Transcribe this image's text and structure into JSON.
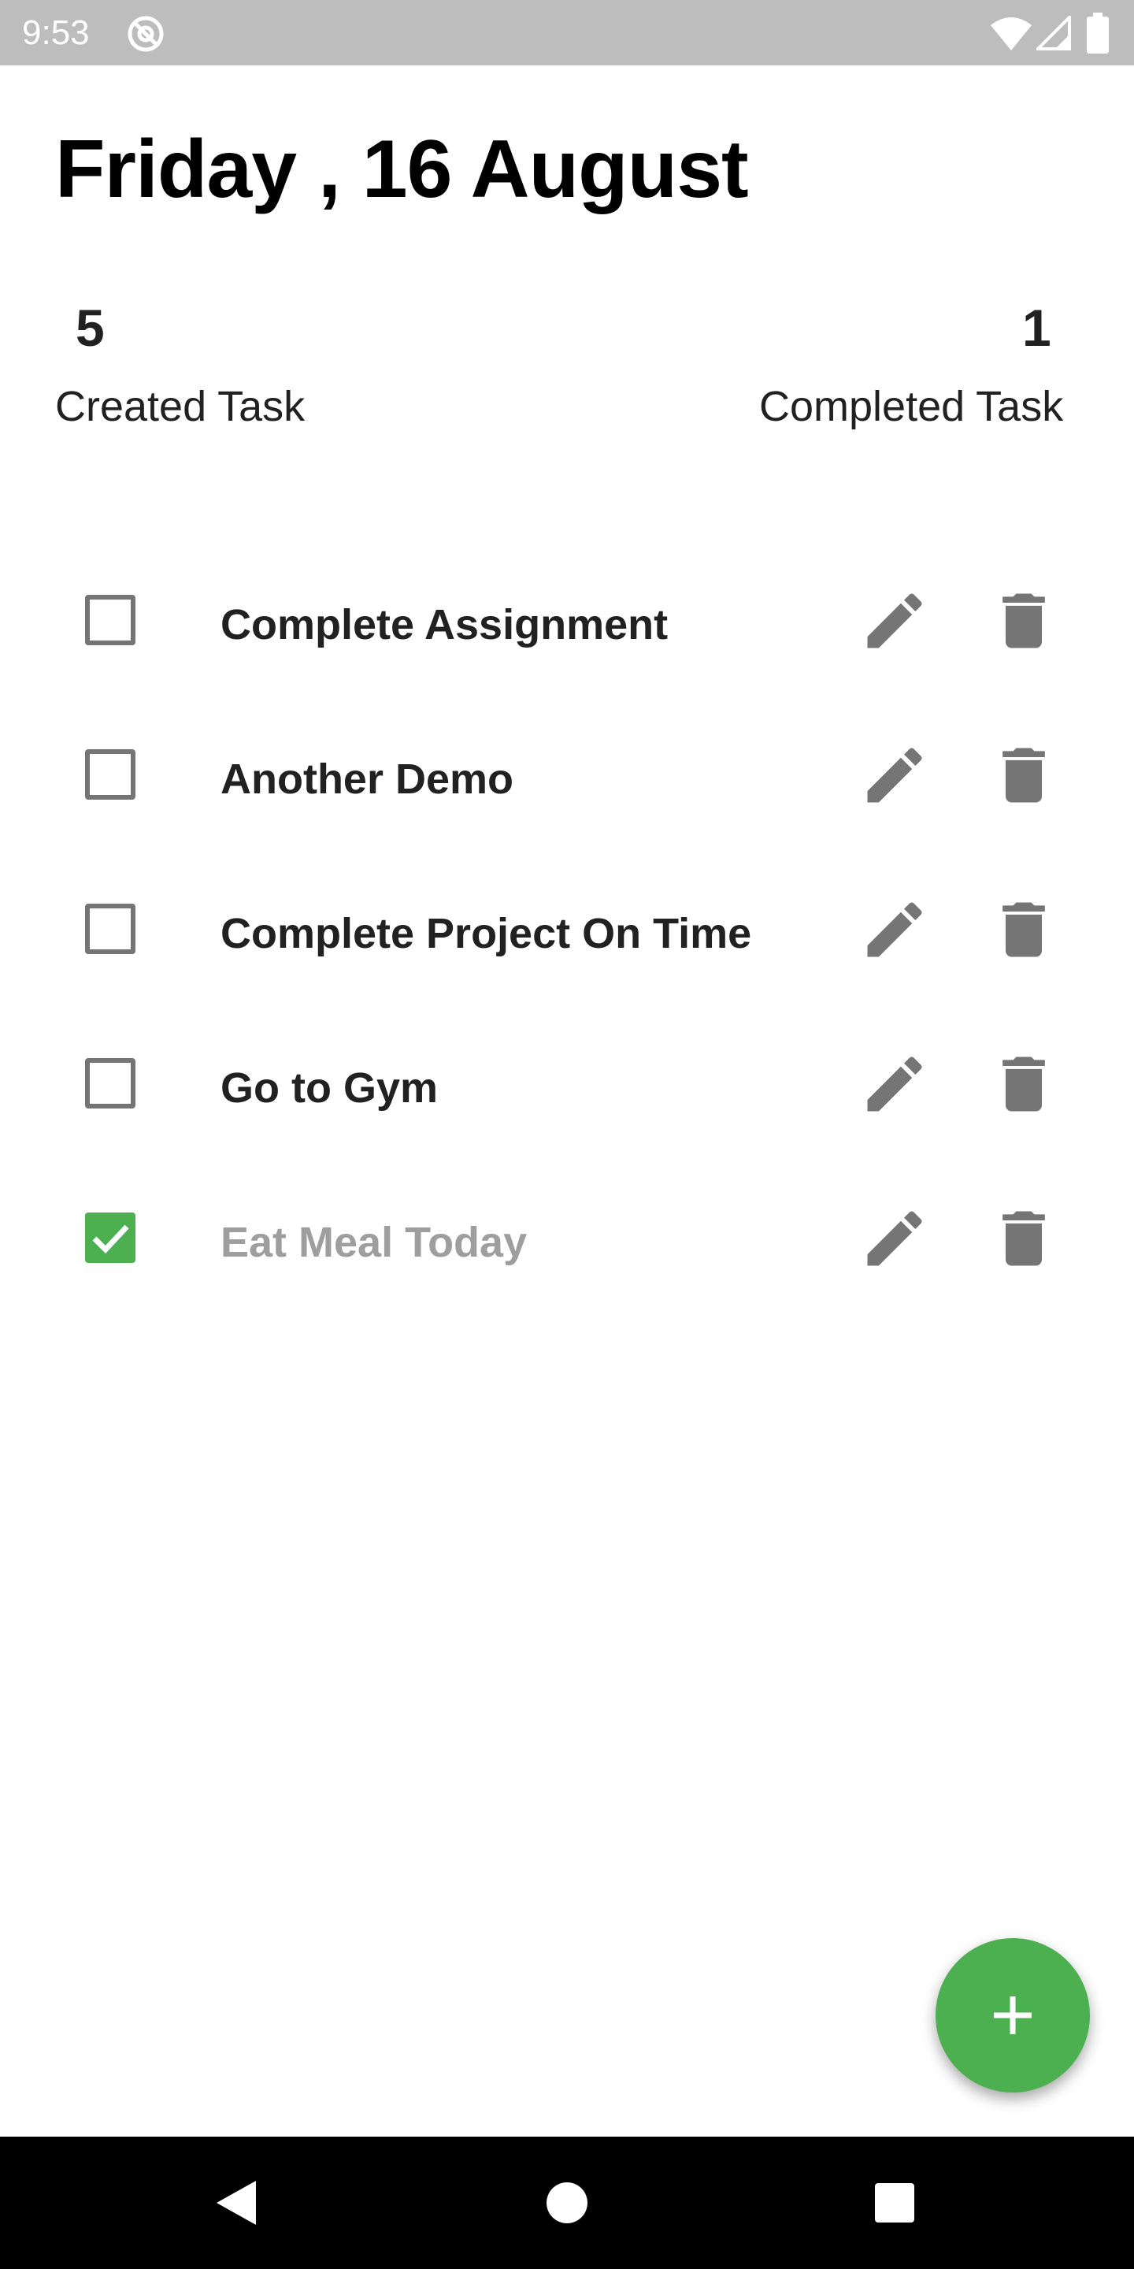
{
  "status_bar": {
    "time": "9:53",
    "icons": [
      "at-sign-icon",
      "wifi-icon",
      "cell-signal-icon",
      "battery-icon"
    ]
  },
  "header": {
    "title": "Friday , 16 August"
  },
  "stats": {
    "created_count": "5",
    "created_label": "Created Task",
    "completed_count": "1",
    "completed_label": "Completed Task"
  },
  "tasks": [
    {
      "title": "Complete Assignment",
      "checked": false
    },
    {
      "title": "Another Demo",
      "checked": false
    },
    {
      "title": "Complete Project On Time",
      "checked": false
    },
    {
      "title": "Go to Gym",
      "checked": false
    },
    {
      "title": "Eat Meal Today",
      "checked": true
    }
  ],
  "task_actions": [
    "pencil-icon",
    "trash-icon"
  ],
  "fab": {
    "icon": "plus-icon"
  },
  "nav_bar": {
    "buttons": [
      "back-icon",
      "home-icon",
      "recents-icon"
    ]
  },
  "colors": {
    "accent": "#4caf50",
    "icon_gray": "#757575",
    "status_bar": "#bdbdbd",
    "completed_text": "#9e9e9e"
  }
}
